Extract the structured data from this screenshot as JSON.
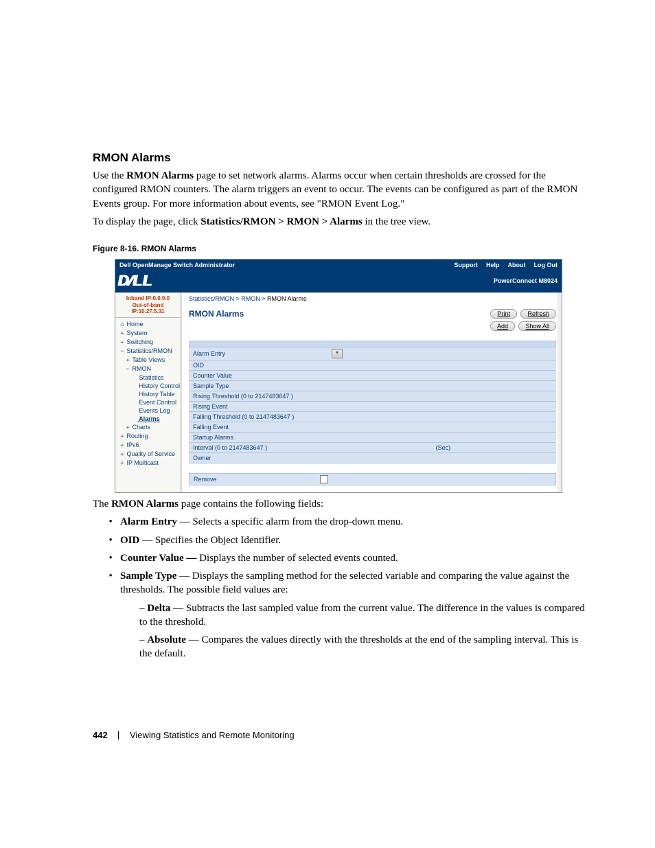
{
  "section_title": "RMON Alarms",
  "intro1_a": "Use the ",
  "intro1_b": "RMON Alarms",
  "intro1_c": " page to set network alarms. Alarms occur when certain thresholds are crossed for the configured RMON counters. The alarm triggers an event to occur. The events can be configured as part of the RMON Events group. For more information about events, see \"RMON Event Log.\"",
  "intro2_a": "To display the page, click ",
  "intro2_b": "Statistics/RMON > RMON > Alarms",
  "intro2_c": " in the tree view.",
  "figure_label": "Figure 8-16.    RMON Alarms",
  "shot": {
    "app_title": "Dell OpenManage Switch Administrator",
    "top_links": [
      "Support",
      "Help",
      "About",
      "Log Out"
    ],
    "brand": "DELL",
    "device": "PowerConnect M8024",
    "ip_line1": "Inband IP:0.0.0.0",
    "ip_line2": "Out-of-band IP:10.27.5.31",
    "tree": [
      {
        "label": "Home",
        "lvl": 0,
        "glyph": "⌂"
      },
      {
        "label": "System",
        "lvl": 0,
        "glyph": "+"
      },
      {
        "label": "Switching",
        "lvl": 0,
        "glyph": "+"
      },
      {
        "label": "Statistics/RMON",
        "lvl": 0,
        "glyph": "−"
      },
      {
        "label": "Table Views",
        "lvl": 1,
        "glyph": "+"
      },
      {
        "label": "RMON",
        "lvl": 1,
        "glyph": "−"
      },
      {
        "label": "Statistics",
        "lvl": 2,
        "glyph": ""
      },
      {
        "label": "History Control",
        "lvl": 2,
        "glyph": ""
      },
      {
        "label": "History Table",
        "lvl": 2,
        "glyph": ""
      },
      {
        "label": "Event Control",
        "lvl": 2,
        "glyph": ""
      },
      {
        "label": "Events Log",
        "lvl": 2,
        "glyph": ""
      },
      {
        "label": "Alarms",
        "lvl": 2,
        "glyph": "",
        "current": true
      },
      {
        "label": "Charts",
        "lvl": 1,
        "glyph": "+"
      },
      {
        "label": "Routing",
        "lvl": 0,
        "glyph": "+"
      },
      {
        "label": "IPv6",
        "lvl": 0,
        "glyph": "+"
      },
      {
        "label": "Quality of Service",
        "lvl": 0,
        "glyph": "+"
      },
      {
        "label": "IP Multicast",
        "lvl": 0,
        "glyph": "+"
      }
    ],
    "crumbs": {
      "a": "Statistics/RMON",
      "b": "RMON",
      "c": "RMON Alarms"
    },
    "panel_title": "RMON Alarms",
    "buttons_row1": [
      "Print",
      "Refresh"
    ],
    "buttons_row2": [
      "Add",
      "Show All"
    ],
    "rows": [
      {
        "label": "Alarm Entry",
        "ctl": "dropdown"
      },
      {
        "label": "OID",
        "ctl": ""
      },
      {
        "label": "Counter Value",
        "ctl": ""
      },
      {
        "label": "Sample Type",
        "ctl": ""
      },
      {
        "label": "Rising Threshold (0 to 2147483647 )",
        "ctl": ""
      },
      {
        "label": "Rising Event",
        "ctl": ""
      },
      {
        "label": "Falling Threshold (0 to 2147483647 )",
        "ctl": ""
      },
      {
        "label": "Falling Event",
        "ctl": ""
      },
      {
        "label": "Startup Alarms",
        "ctl": ""
      },
      {
        "label": "Interval (0 to 2147483647 )",
        "ctl": "sec",
        "unit": "(Sec)"
      },
      {
        "label": "Owner",
        "ctl": ""
      }
    ],
    "remove_label": "Remove"
  },
  "after_a": "The ",
  "after_b": "RMON Alarms",
  "after_c": " page contains the following fields:",
  "fields": [
    {
      "name": "Alarm Entry",
      "desc": " — Selects a specific alarm from the drop-down menu."
    },
    {
      "name": "OID",
      "desc": " — Specifies the Object Identifier."
    },
    {
      "name": "Counter Value — ",
      "desc": "Displays the number of selected events counted."
    },
    {
      "name": "Sample Type",
      "desc": " — Displays the sampling method for the selected variable and comparing the value against the thresholds. The possible field values are:",
      "sub": [
        {
          "name": "Delta",
          "desc": " — Subtracts the last sampled value from the current value. The difference in the values is compared to the threshold."
        },
        {
          "name": "Absolute",
          "desc": " — Compares the values directly with the thresholds at the end of the sampling interval. This is the default."
        }
      ]
    }
  ],
  "footer": {
    "page": "442",
    "chapter": "Viewing Statistics and Remote Monitoring"
  }
}
